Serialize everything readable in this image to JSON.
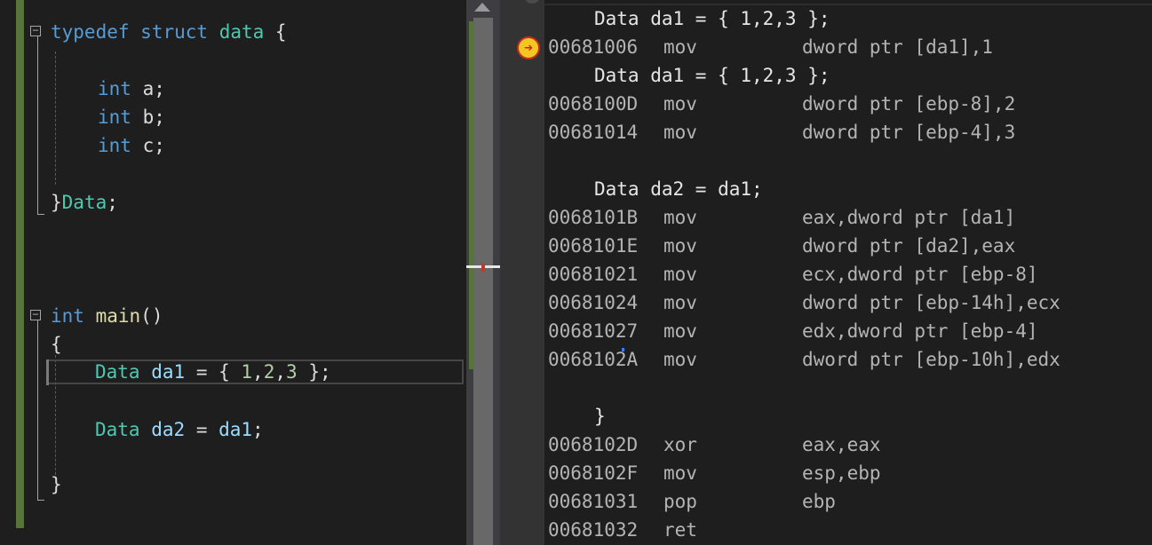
{
  "source_editor": {
    "lines": [
      {
        "id": "l1",
        "tokens": [
          [
            "kw",
            "typedef"
          ],
          [
            "pl",
            " "
          ],
          [
            "kw",
            "struct"
          ],
          [
            "pl",
            " "
          ],
          [
            "typ",
            "data"
          ],
          [
            "pl",
            " {"
          ]
        ]
      },
      {
        "id": "l2",
        "tokens": [
          [
            "kw",
            "int"
          ],
          [
            "pl",
            " a;"
          ]
        ]
      },
      {
        "id": "l3",
        "tokens": [
          [
            "kw",
            "int"
          ],
          [
            "pl",
            " b;"
          ]
        ]
      },
      {
        "id": "l4",
        "tokens": [
          [
            "kw",
            "int"
          ],
          [
            "pl",
            " c;"
          ]
        ]
      },
      {
        "id": "l5",
        "tokens": [
          [
            "pl",
            "}"
          ],
          [
            "typ",
            "Data"
          ],
          [
            "pl",
            ";"
          ]
        ]
      },
      {
        "id": "l6",
        "tokens": [
          [
            "kw",
            "int"
          ],
          [
            "pl",
            " "
          ],
          [
            "fn",
            "main"
          ],
          [
            "pl",
            "()"
          ]
        ]
      },
      {
        "id": "l7",
        "tokens": [
          [
            "pl",
            "{"
          ]
        ]
      },
      {
        "id": "l8",
        "tokens": [
          [
            "typ",
            "Data"
          ],
          [
            "pl",
            " "
          ],
          [
            "var",
            "da1"
          ],
          [
            "pl",
            " = { "
          ],
          [
            "num",
            "1"
          ],
          [
            "pl",
            ","
          ],
          [
            "num",
            "2"
          ],
          [
            "pl",
            ","
          ],
          [
            "num",
            "3"
          ],
          [
            "pl",
            " };"
          ]
        ]
      },
      {
        "id": "l9",
        "tokens": [
          [
            "typ",
            "Data"
          ],
          [
            "pl",
            " "
          ],
          [
            "var",
            "da2"
          ],
          [
            "pl",
            " = "
          ],
          [
            "var",
            "da1"
          ],
          [
            "pl",
            ";"
          ]
        ]
      },
      {
        "id": "l10",
        "tokens": [
          [
            "pl",
            "}"
          ]
        ]
      }
    ],
    "fold_glyph": "−"
  },
  "disassembly": {
    "ip_icon": "current-instruction-arrow-icon",
    "ip_glyph": "➜",
    "rows": [
      {
        "kind": "src",
        "text": "Data da1 = { 1,2,3 };"
      },
      {
        "kind": "asm",
        "addr": "00681006",
        "op": "mov",
        "arg": "dword ptr [da1],1"
      },
      {
        "kind": "src",
        "text": "Data da1 = { 1,2,3 };"
      },
      {
        "kind": "asm",
        "addr": "0068100D",
        "op": "mov",
        "arg": "dword ptr [ebp-8],2"
      },
      {
        "kind": "asm",
        "addr": "00681014",
        "op": "mov",
        "arg": "dword ptr [ebp-4],3"
      },
      {
        "kind": "blank"
      },
      {
        "kind": "src",
        "text": "Data da2 = da1;"
      },
      {
        "kind": "asm",
        "addr": "0068101B",
        "op": "mov",
        "arg": "eax,dword ptr [da1]"
      },
      {
        "kind": "asm",
        "addr": "0068101E",
        "op": "mov",
        "arg": "dword ptr [da2],eax"
      },
      {
        "kind": "asm",
        "addr": "00681021",
        "op": "mov",
        "arg": "ecx,dword ptr [ebp-8]"
      },
      {
        "kind": "asm",
        "addr": "00681024",
        "op": "mov",
        "arg": "dword ptr [ebp-14h],ecx"
      },
      {
        "kind": "asm",
        "addr": "00681027",
        "op": "mov",
        "arg": "edx,dword ptr [ebp-4]"
      },
      {
        "kind": "asm",
        "addr": "0068102A",
        "op": "mov",
        "arg": "dword ptr [ebp-10h],edx"
      },
      {
        "kind": "blank"
      },
      {
        "kind": "src",
        "text": "}"
      },
      {
        "kind": "asm",
        "addr": "0068102D",
        "op": "xor",
        "arg": "eax,eax"
      },
      {
        "kind": "asm",
        "addr": "0068102F",
        "op": "mov",
        "arg": "esp,ebp"
      },
      {
        "kind": "asm",
        "addr": "00681031",
        "op": "pop",
        "arg": "ebp"
      },
      {
        "kind": "asm",
        "addr": "00681032",
        "op": "ret",
        "arg": ""
      }
    ]
  },
  "colors": {
    "background": "#1e1e1e",
    "keyword": "#569cd6",
    "type": "#4ec9b0",
    "function": "#dcdcaa",
    "variable": "#9cdcfe",
    "number": "#b5cea8",
    "change_bar": "#57753b"
  }
}
